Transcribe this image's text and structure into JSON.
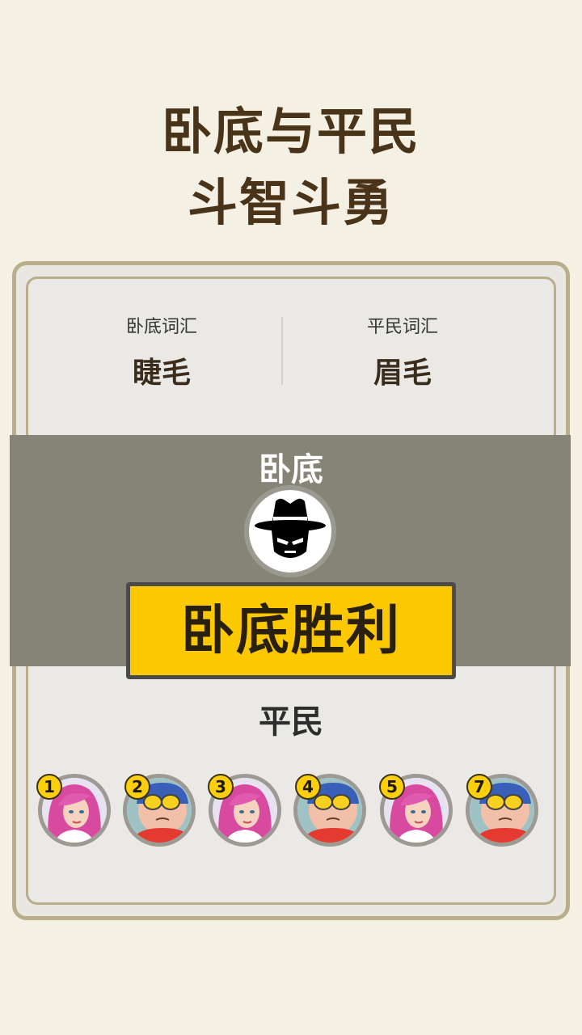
{
  "header": {
    "title_line1": "卧底与平民",
    "title_line2": "斗智斗勇"
  },
  "words": {
    "spy_label": "卧底词汇",
    "spy_word": "睫毛",
    "civilian_label": "平民词汇",
    "civilian_word": "眉毛"
  },
  "result": {
    "spy_role": "卧底",
    "banner": "卧底胜利",
    "civilian_role": "平民",
    "spy_avatar_icon": "spy-hat-icon"
  },
  "players": [
    {
      "number": "1",
      "avatar": "pink-hair-girl-avatar"
    },
    {
      "number": "2",
      "avatar": "goggle-boy-avatar"
    },
    {
      "number": "3",
      "avatar": "pink-hair-girl-avatar"
    },
    {
      "number": "4",
      "avatar": "goggle-boy-avatar"
    },
    {
      "number": "5",
      "avatar": "pink-hair-girl-avatar"
    },
    {
      "number": "7",
      "avatar": "goggle-boy-avatar"
    }
  ],
  "colors": {
    "background": "#f4f0e4",
    "title": "#4a3419",
    "banner": "#fcc800",
    "overlay": "#858477",
    "badge": "#fccf0a"
  }
}
